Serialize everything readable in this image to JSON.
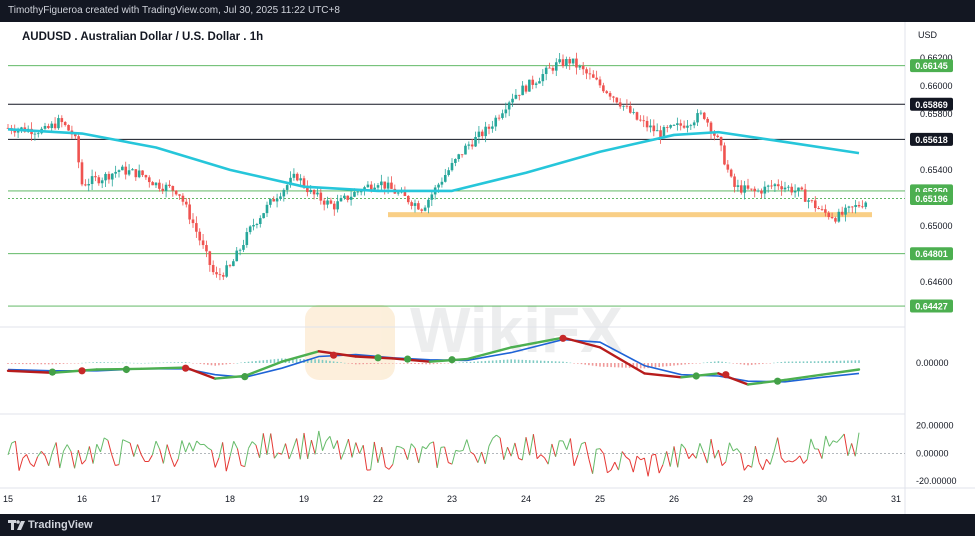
{
  "header": {
    "attribution": "TimothyFigueroa created with TradingView.com, Jul 30, 2025 11:22 UTC+8"
  },
  "footer": {
    "brand": "TradingView"
  },
  "watermark": {
    "text": "WikiFX"
  },
  "colors": {
    "up": "#26a69a",
    "down": "#ef5350",
    "ma": "#26c6da",
    "support_zone": "#f9cf86",
    "macd": "#1e63d6",
    "signal": "#b71c1c",
    "rsi_up": "#4caf50"
  },
  "chart_data": [
    {
      "type": "candlestick",
      "title": "AUDUSD . Australian Dollar / U.S. Dollar . 1h",
      "currency": "USD",
      "y_ticks": [
        "0.66200",
        "0.66000",
        "0.65800",
        "0.65400",
        "0.65000",
        "0.64600"
      ],
      "ylim": [
        0.6437,
        0.663
      ],
      "x_ticks": [
        "15",
        "16",
        "17",
        "18",
        "19",
        "22",
        "23",
        "24",
        "25",
        "26",
        "29",
        "30",
        "31"
      ],
      "price_levels": [
        {
          "label": "0.66145",
          "value": 0.66145,
          "style": "green"
        },
        {
          "label": "0.65869",
          "value": 0.65869,
          "style": "black"
        },
        {
          "label": "0.65618",
          "value": 0.65618,
          "style": "black"
        },
        {
          "label": "0.65250",
          "value": 0.6525,
          "style": "green"
        },
        {
          "label": "0.65196",
          "value": 0.65196,
          "style": "green-current"
        },
        {
          "label": "0.64801",
          "value": 0.64801,
          "style": "green"
        },
        {
          "label": "0.64427",
          "value": 0.64427,
          "style": "green"
        }
      ],
      "support_zone": {
        "value": 0.6508,
        "from_day": "22",
        "to_day": "30"
      },
      "price_path": [
        {
          "t": 0.0,
          "p": 0.657
        },
        {
          "t": 0.5,
          "p": 0.6568
        },
        {
          "t": 0.7,
          "p": 0.6575
        },
        {
          "t": 0.9,
          "p": 0.6564
        },
        {
          "t": 1.0,
          "p": 0.653
        },
        {
          "t": 1.3,
          "p": 0.6535
        },
        {
          "t": 1.5,
          "p": 0.654
        },
        {
          "t": 1.8,
          "p": 0.6537
        },
        {
          "t": 2.0,
          "p": 0.653
        },
        {
          "t": 2.3,
          "p": 0.6525
        },
        {
          "t": 2.5,
          "p": 0.6502
        },
        {
          "t": 2.8,
          "p": 0.6463
        },
        {
          "t": 3.0,
          "p": 0.647
        },
        {
          "t": 3.3,
          "p": 0.65
        },
        {
          "t": 3.6,
          "p": 0.652
        },
        {
          "t": 3.9,
          "p": 0.6536
        },
        {
          "t": 4.1,
          "p": 0.6523
        },
        {
          "t": 4.4,
          "p": 0.6514
        },
        {
          "t": 4.7,
          "p": 0.6524
        },
        {
          "t": 5.0,
          "p": 0.6532
        },
        {
          "t": 5.3,
          "p": 0.6522
        },
        {
          "t": 5.6,
          "p": 0.6513
        },
        {
          "t": 5.9,
          "p": 0.6536
        },
        {
          "t": 6.2,
          "p": 0.6557
        },
        {
          "t": 6.5,
          "p": 0.657
        },
        {
          "t": 6.8,
          "p": 0.6592
        },
        {
          "t": 7.1,
          "p": 0.6603
        },
        {
          "t": 7.4,
          "p": 0.6615
        },
        {
          "t": 7.6,
          "p": 0.6618
        },
        {
          "t": 7.9,
          "p": 0.6605
        },
        {
          "t": 8.2,
          "p": 0.6592
        },
        {
          "t": 8.5,
          "p": 0.6576
        },
        {
          "t": 8.8,
          "p": 0.6566
        },
        {
          "t": 9.1,
          "p": 0.6572
        },
        {
          "t": 9.4,
          "p": 0.658
        },
        {
          "t": 9.6,
          "p": 0.656
        },
        {
          "t": 9.8,
          "p": 0.6528
        },
        {
          "t": 10.1,
          "p": 0.6524
        },
        {
          "t": 10.4,
          "p": 0.653
        },
        {
          "t": 10.7,
          "p": 0.6524
        },
        {
          "t": 11.0,
          "p": 0.651
        },
        {
          "t": 11.2,
          "p": 0.6506
        },
        {
          "t": 11.4,
          "p": 0.6512
        },
        {
          "t": 11.6,
          "p": 0.6518
        }
      ],
      "ma_path": [
        {
          "t": 0.0,
          "p": 0.6569
        },
        {
          "t": 1.0,
          "p": 0.6566
        },
        {
          "t": 2.0,
          "p": 0.6556
        },
        {
          "t": 3.0,
          "p": 0.654
        },
        {
          "t": 4.0,
          "p": 0.6528
        },
        {
          "t": 5.0,
          "p": 0.6525
        },
        {
          "t": 6.0,
          "p": 0.6525
        },
        {
          "t": 7.0,
          "p": 0.6538
        },
        {
          "t": 8.0,
          "p": 0.6553
        },
        {
          "t": 9.0,
          "p": 0.6565
        },
        {
          "t": 9.6,
          "p": 0.6567
        },
        {
          "t": 10.5,
          "p": 0.656
        },
        {
          "t": 11.5,
          "p": 0.6552
        }
      ]
    },
    {
      "type": "macd",
      "y_ticks": [
        "0.00000"
      ],
      "macd_path": [
        {
          "t": 0.0,
          "p": -0.6
        },
        {
          "t": 0.6,
          "p": -0.75
        },
        {
          "t": 1.2,
          "p": -0.5
        },
        {
          "t": 1.8,
          "p": -0.45
        },
        {
          "t": 2.4,
          "p": -0.35
        },
        {
          "t": 2.8,
          "p": -1.2
        },
        {
          "t": 3.2,
          "p": -1.0
        },
        {
          "t": 3.7,
          "p": 0.1
        },
        {
          "t": 4.2,
          "p": 0.9
        },
        {
          "t": 4.7,
          "p": 0.5
        },
        {
          "t": 5.2,
          "p": 0.35
        },
        {
          "t": 5.7,
          "p": 0.1
        },
        {
          "t": 6.2,
          "p": 0.3
        },
        {
          "t": 6.8,
          "p": 1.2
        },
        {
          "t": 7.5,
          "p": 1.95
        },
        {
          "t": 8.0,
          "p": 1.2
        },
        {
          "t": 8.6,
          "p": -0.8
        },
        {
          "t": 9.1,
          "p": -1.1
        },
        {
          "t": 9.6,
          "p": -0.8
        },
        {
          "t": 10.0,
          "p": -1.65
        },
        {
          "t": 10.5,
          "p": -1.3
        },
        {
          "t": 11.0,
          "p": -0.9
        },
        {
          "t": 11.5,
          "p": -0.5
        }
      ],
      "signal_path": [
        {
          "t": 0.0,
          "p": -0.5
        },
        {
          "t": 0.6,
          "p": -0.6
        },
        {
          "t": 1.2,
          "p": -0.6
        },
        {
          "t": 1.8,
          "p": -0.45
        },
        {
          "t": 2.4,
          "p": -0.45
        },
        {
          "t": 2.8,
          "p": -0.9
        },
        {
          "t": 3.2,
          "p": -1.1
        },
        {
          "t": 3.7,
          "p": -0.4
        },
        {
          "t": 4.2,
          "p": 0.5
        },
        {
          "t": 4.7,
          "p": 0.65
        },
        {
          "t": 5.2,
          "p": 0.4
        },
        {
          "t": 5.7,
          "p": 0.25
        },
        {
          "t": 6.2,
          "p": 0.2
        },
        {
          "t": 6.8,
          "p": 0.8
        },
        {
          "t": 7.5,
          "p": 1.8
        },
        {
          "t": 8.0,
          "p": 1.6
        },
        {
          "t": 8.6,
          "p": -0.2
        },
        {
          "t": 9.1,
          "p": -0.9
        },
        {
          "t": 9.6,
          "p": -1.0
        },
        {
          "t": 10.0,
          "p": -1.4
        },
        {
          "t": 10.5,
          "p": -1.45
        },
        {
          "t": 11.0,
          "p": -1.1
        },
        {
          "t": 11.5,
          "p": -0.8
        }
      ],
      "cross_points": [
        {
          "t": 0.6,
          "p": -0.7,
          "kind": "bull"
        },
        {
          "t": 1.0,
          "p": -0.6,
          "kind": "bear"
        },
        {
          "t": 1.6,
          "p": -0.5,
          "kind": "bull"
        },
        {
          "t": 2.4,
          "p": -0.4,
          "kind": "bear"
        },
        {
          "t": 3.2,
          "p": -1.05,
          "kind": "bull"
        },
        {
          "t": 4.4,
          "p": 0.6,
          "kind": "bear"
        },
        {
          "t": 5.0,
          "p": 0.4,
          "kind": "bull"
        },
        {
          "t": 5.4,
          "p": 0.3,
          "kind": "bull"
        },
        {
          "t": 6.0,
          "p": 0.25,
          "kind": "bull"
        },
        {
          "t": 7.5,
          "p": 1.9,
          "kind": "bear"
        },
        {
          "t": 9.3,
          "p": -1.0,
          "kind": "bull"
        },
        {
          "t": 9.7,
          "p": -0.9,
          "kind": "bear"
        },
        {
          "t": 10.4,
          "p": -1.4,
          "kind": "bull"
        }
      ]
    },
    {
      "type": "oscillator",
      "y_ticks": [
        "20.00000",
        "0.00000",
        "-20.00000"
      ],
      "ylim": [
        -22,
        24
      ]
    }
  ]
}
